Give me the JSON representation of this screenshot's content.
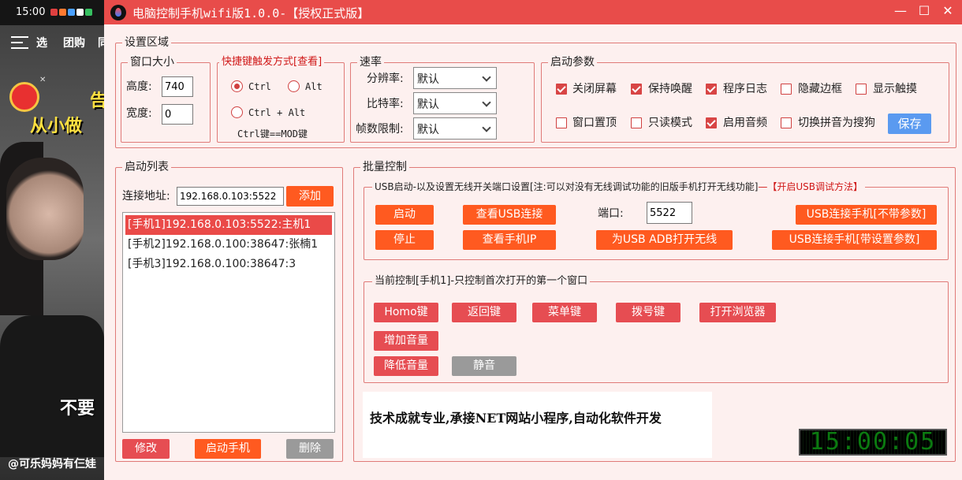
{
  "phone": {
    "time": "15:00",
    "nav": [
      "选",
      "团购",
      "同"
    ],
    "headline1": "告",
    "headline2": "从小做",
    "subtitle": "不要",
    "username": "@可乐妈妈有仨娃"
  },
  "window": {
    "title": "电脑控制手机wifi版1.0.0-【授权正式版】",
    "minimize": "—",
    "maximize": "☐",
    "close": "✕"
  },
  "settings": {
    "section_title": "设置区域",
    "window_size": {
      "title": "窗口大小",
      "height_label": "高度:",
      "height_value": "740",
      "width_label": "宽度:",
      "width_value": "0"
    },
    "hotkey": {
      "title": "快捷键触发方式[查看]",
      "options": [
        "Ctrl",
        "Alt",
        "Ctrl + Alt"
      ],
      "selected": "Ctrl",
      "note": "Ctrl键==MOD键"
    },
    "rate": {
      "title": "速率",
      "resolution_label": "分辨率:",
      "resolution_value": "默认",
      "bitrate_label": "比特率:",
      "bitrate_value": "默认",
      "fps_label": "帧数限制:",
      "fps_value": "默认"
    },
    "params": {
      "title": "启动参数",
      "row1": [
        {
          "label": "关闭屏幕",
          "checked": true
        },
        {
          "label": "保持唤醒",
          "checked": true
        },
        {
          "label": "程序日志",
          "checked": true
        },
        {
          "label": "隐藏边框",
          "checked": false
        },
        {
          "label": "显示触摸",
          "checked": false
        }
      ],
      "row2": [
        {
          "label": "窗口置顶",
          "checked": false
        },
        {
          "label": "只读模式",
          "checked": false
        },
        {
          "label": "启用音频",
          "checked": true
        },
        {
          "label": "切换拼音为搜狗",
          "checked": false
        }
      ],
      "save_label": "保存"
    }
  },
  "launch_list": {
    "title": "启动列表",
    "address_label": "连接地址:",
    "address_value": "192.168.0.103:5522",
    "add_label": "添加",
    "items": [
      "[手机1]192.168.0.103:5522:主机1",
      "[手机2]192.168.0.100:38647:张楠1",
      "[手机3]192.168.0.100:38647:3"
    ],
    "edit_label": "修改",
    "start_label": "启动手机",
    "delete_label": "删除"
  },
  "batch": {
    "title": "批量控制",
    "usb": {
      "title": "USB启动-以及设置无线开关端口设置[注:可以对没有无线调试功能的旧版手机打开无线功能]",
      "link": "—【开启USB调试方法】",
      "start_label": "启动",
      "stop_label": "停止",
      "view_usb_label": "查看USB连接",
      "view_ip_label": "查看手机IP",
      "port_label": "端口:",
      "port_value": "5522",
      "open_wireless_label": "为USB ADB打开无线",
      "connect_no_param_label": "USB连接手机[不带参数]",
      "connect_param_label": "USB连接手机[带设置参数]"
    },
    "current": {
      "title": "当前控制[手机1]-只控制首次打开的第一个窗口",
      "home_label": "Homo键",
      "back_label": "返回键",
      "menu_label": "菜单键",
      "dial_label": "拨号键",
      "browser_label": "打开浏览器",
      "vol_up_label": "增加音量",
      "vol_down_label": "降低音量",
      "mute_label": "静音"
    }
  },
  "ad_text": "技术成就专业,承接NET网站小程序,自动化软件开发",
  "clock": "15:00:05",
  "colors": {
    "accent": "#e84c4a",
    "orange": "#ff5a20",
    "background": "#fdf0ef"
  }
}
